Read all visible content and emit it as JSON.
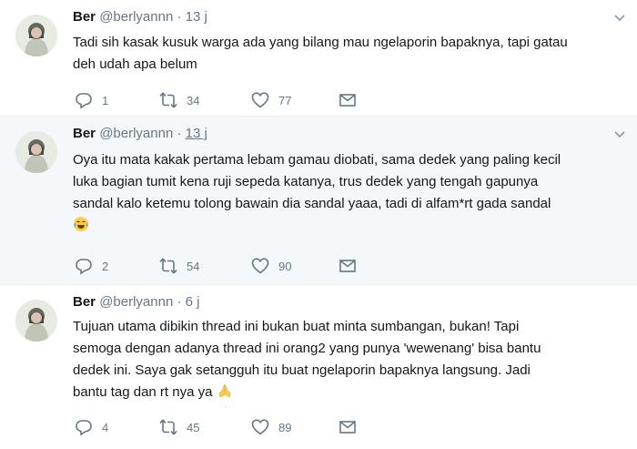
{
  "tweets": [
    {
      "name": "Ber",
      "handle": "@berlyannn",
      "separator": "·",
      "time": "13 j",
      "lines": [
        "Tadi sih kasak kusuk warga ada yang bilang mau ngelaporin bapaknya, tapi gatau",
        "deh udah apa belum"
      ],
      "reply_count": "1",
      "retweet_count": "34",
      "like_count": "77"
    },
    {
      "name": "Ber",
      "handle": "@berlyannn",
      "separator": "·",
      "time": "13 j",
      "lines": [
        "Oya itu mata kakak pertama lebam gamau diobati, sama dedek yang paling kecil",
        "luka bagian tumit  kena ruji sepeda katanya, trus dedek yang tengah gapunya",
        "sandal kalo ketemu tolong bawain dia sandal yaaa, tadi di alfam*rt gada sandal"
      ],
      "emoji": "face-with-tears-of-joy",
      "reply_count": "2",
      "retweet_count": "54",
      "like_count": "90"
    },
    {
      "name": "Ber",
      "handle": "@berlyannn",
      "separator": "·",
      "time": "6 j",
      "lines": [
        "Tujuan utama dibikin thread ini bukan buat minta sumbangan, bukan! Tapi",
        "semoga dengan adanya thread ini orang2 yang punya 'wewenang' bisa bantu",
        "dedek ini. Saya gak setangguh itu buat ngelaporin bapaknya langsung. Jadi",
        "bantu tag dan rt nya ya"
      ],
      "emoji": "folded-hands",
      "reply_count": "4",
      "retweet_count": "45",
      "like_count": "89"
    }
  ],
  "colors": {
    "text": "#14171a",
    "secondary": "#657786",
    "divider": "#e6ecf0",
    "highlight_bg": "#f5f8fa"
  },
  "icons": [
    "avatar",
    "chevron-down-icon",
    "reply-icon",
    "retweet-icon",
    "like-icon",
    "message-icon"
  ]
}
